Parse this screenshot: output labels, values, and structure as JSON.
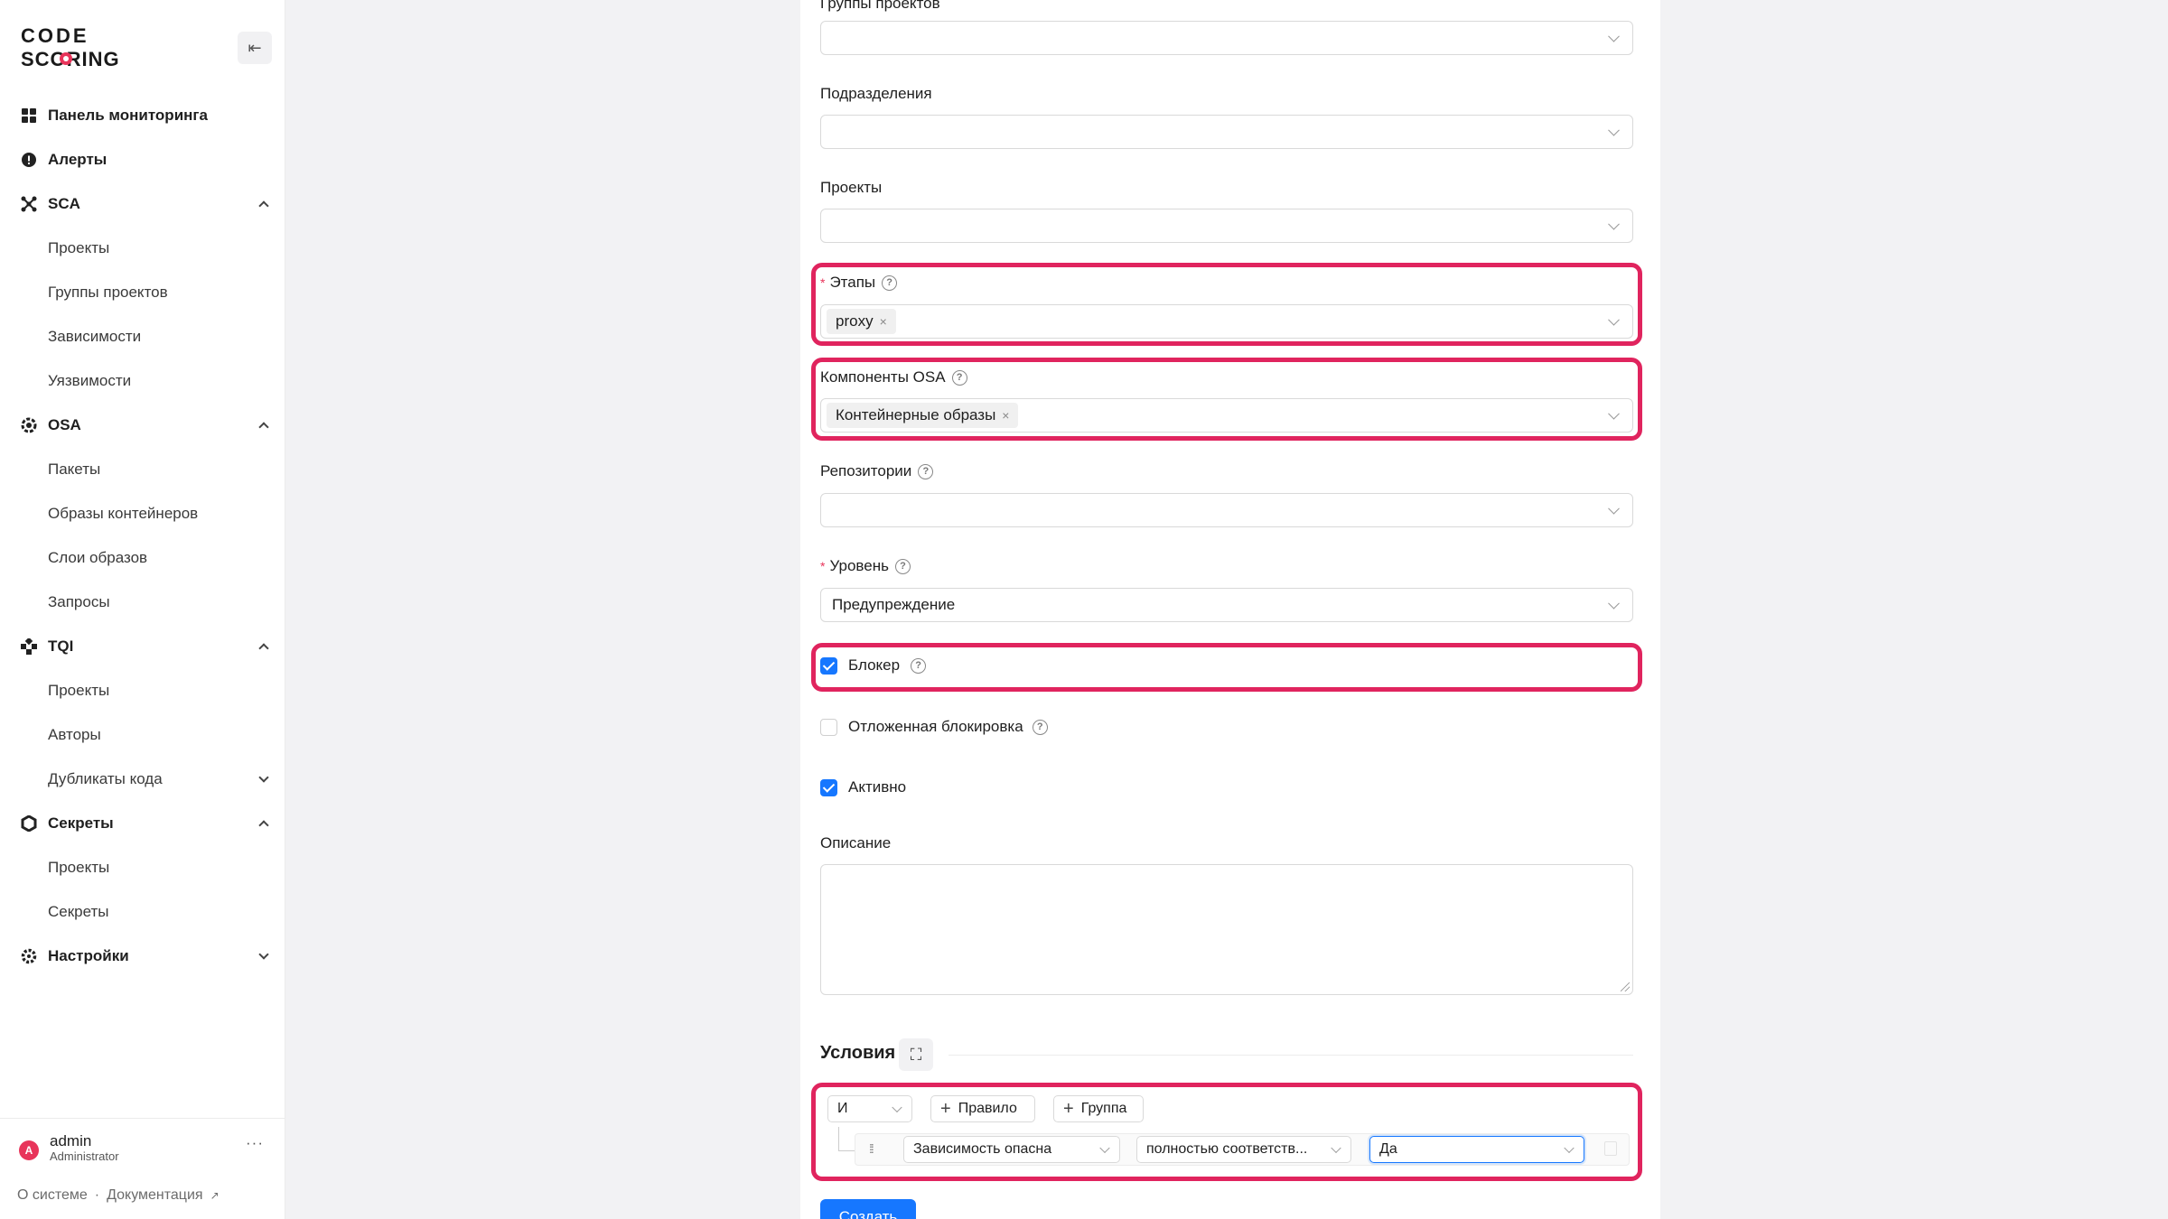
{
  "brand": {
    "logo_line1": "CODE",
    "logo_line2": "SCORING",
    "accent": "#e8345a"
  },
  "sidebar": {
    "collapse_icon": "collapse-left-icon",
    "items": [
      {
        "label": "Панель мониторинга",
        "icon": "dashboard-grid-icon"
      },
      {
        "label": "Алерты",
        "icon": "alert-circle-icon"
      },
      {
        "label": "SCA",
        "icon": "sca-network-icon",
        "expanded": true
      },
      {
        "label": "Проекты"
      },
      {
        "label": "Группы проектов"
      },
      {
        "label": "Зависимости"
      },
      {
        "label": "Уязвимости"
      },
      {
        "label": "OSA",
        "icon": "osa-gear-icon",
        "expanded": true
      },
      {
        "label": "Пакеты"
      },
      {
        "label": "Образы контейнеров"
      },
      {
        "label": "Слои образов"
      },
      {
        "label": "Запросы"
      },
      {
        "label": "TQI",
        "icon": "tqi-icon",
        "expanded": true
      },
      {
        "label": "Проекты"
      },
      {
        "label": "Авторы"
      },
      {
        "label": "Дубликаты кода"
      },
      {
        "label": "Секреты",
        "icon": "secrets-icon",
        "expanded": true
      },
      {
        "label": "Проекты"
      },
      {
        "label": "Секреты"
      },
      {
        "label": "Настройки",
        "icon": "settings-gear-icon"
      }
    ],
    "user": {
      "initial": "A",
      "name": "admin",
      "role": "Administrator",
      "more": "···"
    },
    "footer": {
      "about": "О системе",
      "separator": "·",
      "docs": "Документация"
    }
  },
  "form": {
    "project_groups_label": "Группы проектов",
    "divisions_label": "Подразделения",
    "projects_label": "Проекты",
    "stages_label": "Этапы",
    "stages_required": "*",
    "stages_tag": "proxy",
    "osa_components_label": "Компоненты OSA",
    "osa_components_tag": "Контейнерные образы",
    "repositories_label": "Репозитории",
    "level_label": "Уровень",
    "level_required": "*",
    "level_value": "Предупреждение",
    "blocker_label": "Блокер",
    "blocker_checked": true,
    "deferred_label": "Отложенная блокировка",
    "deferred_checked": false,
    "active_label": "Активно",
    "active_checked": true,
    "description_label": "Описание",
    "description_value": "",
    "help_icon": "?",
    "tag_close": "×"
  },
  "conditions": {
    "title": "Условия",
    "expand_icon": "⛶",
    "conjunction": "И",
    "add_rule": "Правило",
    "add_group": "Группа",
    "plus": "+",
    "drag_icon": "⁞⁞",
    "rule": {
      "field": "Зависимость опасна",
      "operator": "полностью соответств...",
      "value": "Да"
    }
  },
  "submit_label": "Создать",
  "colors": {
    "highlight": "#e0245e",
    "primary": "#1677ff",
    "checkbox_on": "#1677ff"
  }
}
